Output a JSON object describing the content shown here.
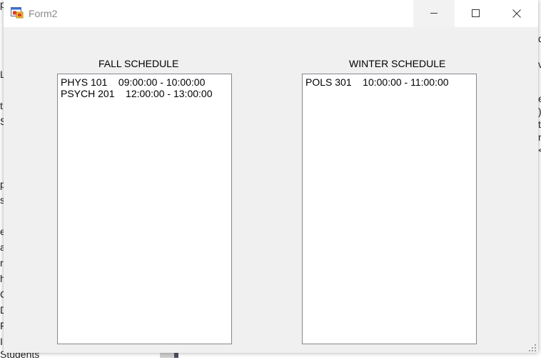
{
  "window": {
    "title": "Form2"
  },
  "fall": {
    "label": "FALL SCHEDULE",
    "items": [
      "PHYS 101    09:00:00 - 10:00:00",
      "PSYCH 201    12:00:00 - 13:00:00"
    ]
  },
  "winter": {
    "label": "WINTER SCHEDULE",
    "items": [
      "POLS 301    10:00:00 - 11:00:00"
    ]
  },
  "background": {
    "left_chars": [
      "p",
      "",
      "",
      "",
      "L",
      "",
      "t",
      "S",
      "",
      "",
      "",
      "",
      "p",
      "s",
      "",
      "e",
      "a",
      "r",
      "h",
      "C",
      "D",
      "F",
      "I"
    ],
    "bottom_text": "Students",
    "right_chars": [
      "d",
      "",
      "v",
      "",
      "",
      "e",
      ")",
      "t",
      "r",
      "<",
      "<"
    ]
  },
  "icons": {
    "app": "form-app-icon",
    "minimize": "minimize-icon",
    "maximize": "maximize-icon",
    "close": "close-icon",
    "grip": "size-grip-icon"
  }
}
